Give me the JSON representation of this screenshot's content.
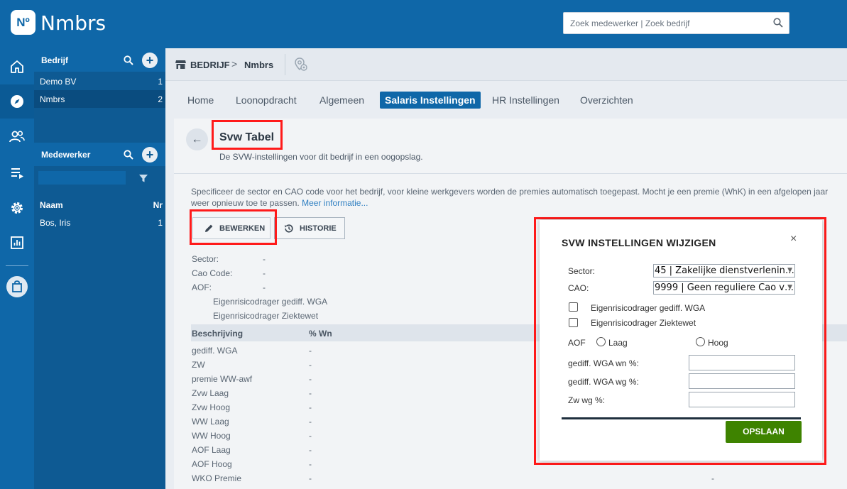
{
  "app": {
    "logo_mark": "Nº",
    "logo_text": "Nmbrs",
    "search_placeholder": "Zoek medewerker | Zoek bedrijf"
  },
  "rail": {
    "icons": [
      "home-icon",
      "compass-icon",
      "users-icon",
      "list-play-icon",
      "gear-icon",
      "chart-icon",
      "bag-icon"
    ],
    "active": "compass-icon"
  },
  "sidebar": {
    "company_section": {
      "title": "Bedrijf",
      "items": [
        {
          "name": "Demo BV",
          "nr": "1"
        },
        {
          "name": "Nmbrs",
          "nr": "2"
        }
      ],
      "selected": "Nmbrs"
    },
    "employee_section": {
      "title": "Medewerker",
      "col_name": "Naam",
      "col_nr": "Nr",
      "items": [
        {
          "name": "Bos, Iris",
          "nr": "1"
        }
      ]
    }
  },
  "breadcrumb": {
    "section": "BEDRIJF",
    "separator": ">",
    "company": "Nmbrs"
  },
  "tabs": [
    {
      "label": "Home",
      "active": false
    },
    {
      "label": "Loonopdracht",
      "active": false
    },
    {
      "label": "Algemeen",
      "active": false
    },
    {
      "label": "Salaris Instellingen",
      "active": true
    },
    {
      "label": "HR Instellingen",
      "active": false
    },
    {
      "label": "Overzichten",
      "active": false
    }
  ],
  "page": {
    "back": "←",
    "title": "Svw Tabel",
    "subtitle": "De SVW-instellingen voor dit bedrijf in een oogopslag.",
    "desc_line1": "Specificeer de sector en CAO code voor het bedrijf, voor kleine werkgevers worden de premies automatisch toegepast. Mocht je een premie (WhK) in een afgelopen jaar",
    "desc_line2": "weer opnieuw toe te passen.",
    "more_link": "Meer informatie...",
    "edit_button": "BEWERKEN",
    "history_button": "HISTORIE",
    "fields": [
      {
        "label": "Sector:",
        "value": "-"
      },
      {
        "label": "Cao Code:",
        "value": "-"
      },
      {
        "label": "AOF:",
        "value": "-"
      }
    ],
    "sub_items": [
      "Eigenrisicodrager gediff. WGA",
      "Eigenrisicodrager Ziektewet"
    ],
    "table": {
      "columns": [
        "Beschrijving",
        "% Wn"
      ],
      "rows": [
        {
          "desc": "gediff. WGA",
          "wn": "-"
        },
        {
          "desc": "ZW",
          "wn": "-"
        },
        {
          "desc": "premie WW-awf",
          "wn": "-"
        },
        {
          "desc": "Zvw Laag",
          "wn": "-"
        },
        {
          "desc": "Zvw Hoog",
          "wn": "-"
        },
        {
          "desc": "WW Laag",
          "wn": "-"
        },
        {
          "desc": "WW Hoog",
          "wn": "-"
        },
        {
          "desc": "AOF Laag",
          "wn": "-"
        },
        {
          "desc": "AOF Hoog",
          "wn": "-"
        },
        {
          "desc": "WKO Premie",
          "wn": "-"
        }
      ],
      "trailing_dash": "-"
    }
  },
  "modal": {
    "title": "SVW INSTELLINGEN WIJZIGEN",
    "close": "×",
    "sector_label": "Sector:",
    "sector_value": "45 | Zakelijke dienstverlenin…",
    "cao_label": "CAO:",
    "cao_value": "9999 | Geen reguliere Cao v…",
    "check1": "Eigenrisicodrager gediff. WGA",
    "check2": "Eigenrisicodrager Ziektewet",
    "aof_label": "AOF",
    "radio_low": "Laag",
    "radio_high": "Hoog",
    "field1": "gediff. WGA wn %:",
    "field2": "gediff. WGA wg %:",
    "field3": "Zw wg %:",
    "save": "OPSLAAN"
  },
  "colors": {
    "brand_blue": "#0f67a8",
    "save_green": "#3e8300",
    "highlight_red": "#ff1a1a"
  }
}
